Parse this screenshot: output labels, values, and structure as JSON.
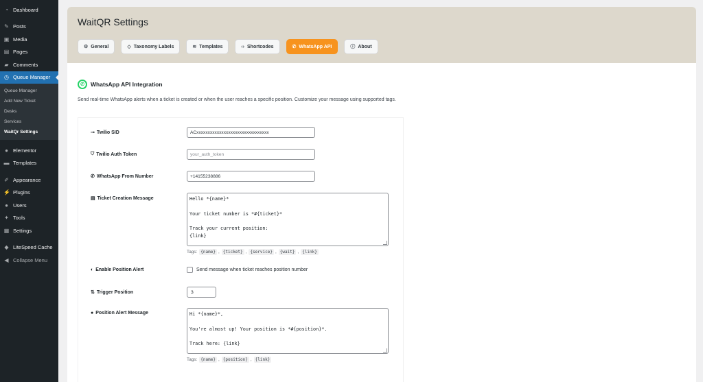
{
  "sidebar": {
    "items": [
      {
        "label": "Dashboard",
        "icon": "dashboard-icon"
      },
      {
        "label": "Posts",
        "icon": "pin-icon"
      },
      {
        "label": "Media",
        "icon": "media-icon"
      },
      {
        "label": "Pages",
        "icon": "pages-icon"
      },
      {
        "label": "Comments",
        "icon": "comment-icon"
      },
      {
        "label": "Queue Manager",
        "icon": "clock-icon"
      },
      {
        "label": "Elementor",
        "icon": "elementor-icon"
      },
      {
        "label": "Templates",
        "icon": "folder-icon"
      },
      {
        "label": "Appearance",
        "icon": "brush-icon"
      },
      {
        "label": "Plugins",
        "icon": "plug-icon"
      },
      {
        "label": "Users",
        "icon": "user-icon"
      },
      {
        "label": "Tools",
        "icon": "wrench-icon"
      },
      {
        "label": "Settings",
        "icon": "settings-icon"
      },
      {
        "label": "LiteSpeed Cache",
        "icon": "litespeed-icon"
      },
      {
        "label": "Collapse Menu",
        "icon": "collapse-icon"
      }
    ],
    "submenu": [
      "Queue Manager",
      "Add New Ticket",
      "Desks",
      "Services",
      "WaitQr Settings"
    ]
  },
  "header": {
    "title": "WaitQR Settings",
    "tabs": [
      {
        "label": "General",
        "icon": "gear-icon"
      },
      {
        "label": "Taxonomy Labels",
        "icon": "tag-icon"
      },
      {
        "label": "Templates",
        "icon": "layers-icon"
      },
      {
        "label": "Shortcodes",
        "icon": "code-icon"
      },
      {
        "label": "WhatsApp API",
        "icon": "whatsapp-icon"
      },
      {
        "label": "About",
        "icon": "info-icon"
      }
    ],
    "active_tab": "WhatsApp API",
    "active_color": "#f7931e"
  },
  "section": {
    "title": "WhatsApp API Integration",
    "description": "Send real-time WhatsApp alerts when a ticket is created or when the user reaches a specific position. Customize your message using supported tags."
  },
  "form": {
    "twilio_sid": {
      "label": "Twilio SID",
      "value": "ACxxxxxxxxxxxxxxxxxxxxxxxxxxxxxxxx"
    },
    "twilio_token": {
      "label": "Twilio Auth Token",
      "placeholder": "your_auth_token"
    },
    "from_number": {
      "label": "WhatsApp From Number",
      "value": "+14155238886"
    },
    "ticket_message": {
      "label": "Ticket Creation Message",
      "value": "Hello *{name}*\n\nYour ticket number is *#{ticket}*\n\nTrack your current position:\n{link}",
      "tags_label": "Tags:",
      "tags": [
        "{name}",
        "{ticket}",
        "{service}",
        "{wait}",
        "{link}"
      ]
    },
    "position_alert": {
      "label": "Enable Position Alert",
      "checkbox_label": "Send message when ticket reaches position number",
      "checked": false
    },
    "trigger_position": {
      "label": "Trigger Position",
      "value": "3"
    },
    "position_message": {
      "label": "Position Alert Message",
      "value": "Hi *{name}*,\n\nYou're almost up! Your position is *#{position}*.\n\nTrack here: {link}",
      "tags_label": "Tags:",
      "tags": [
        "{name}",
        "{position}",
        "{link}"
      ]
    }
  }
}
